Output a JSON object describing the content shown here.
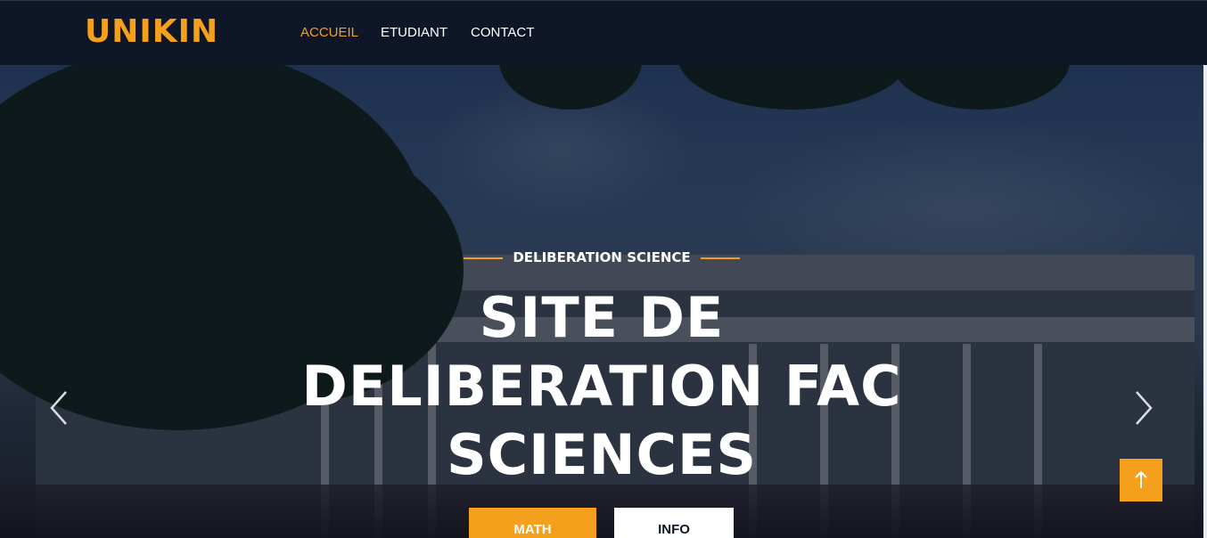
{
  "navbar": {
    "brand": "UNIKIN",
    "links": [
      {
        "label": "ACCUEIL",
        "active": true
      },
      {
        "label": "ETUDIANT",
        "active": false
      },
      {
        "label": "CONTACT",
        "active": false
      }
    ]
  },
  "hero": {
    "subtitle": "DELIBERATION SCIENCE",
    "title_lines": [
      "SITE DE",
      "DELIBERATION FAC",
      "SCIENCES"
    ],
    "buttons": {
      "primary_label": "MATH",
      "secondary_label": "INFO"
    },
    "icons": {
      "prev": "chevron-left-icon",
      "next": "chevron-right-icon",
      "back_to_top": "arrow-up-icon"
    }
  },
  "colors": {
    "accent": "#f4a01c",
    "nav_bg": "#0e1628",
    "text_light": "#ffffff"
  }
}
